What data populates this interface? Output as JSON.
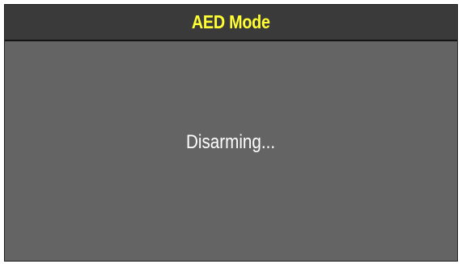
{
  "header": {
    "title": "AED Mode",
    "title_color": "#ffff33",
    "background": "#3a3a3a"
  },
  "main": {
    "status_message": "Disarming...",
    "background": "#646464"
  }
}
